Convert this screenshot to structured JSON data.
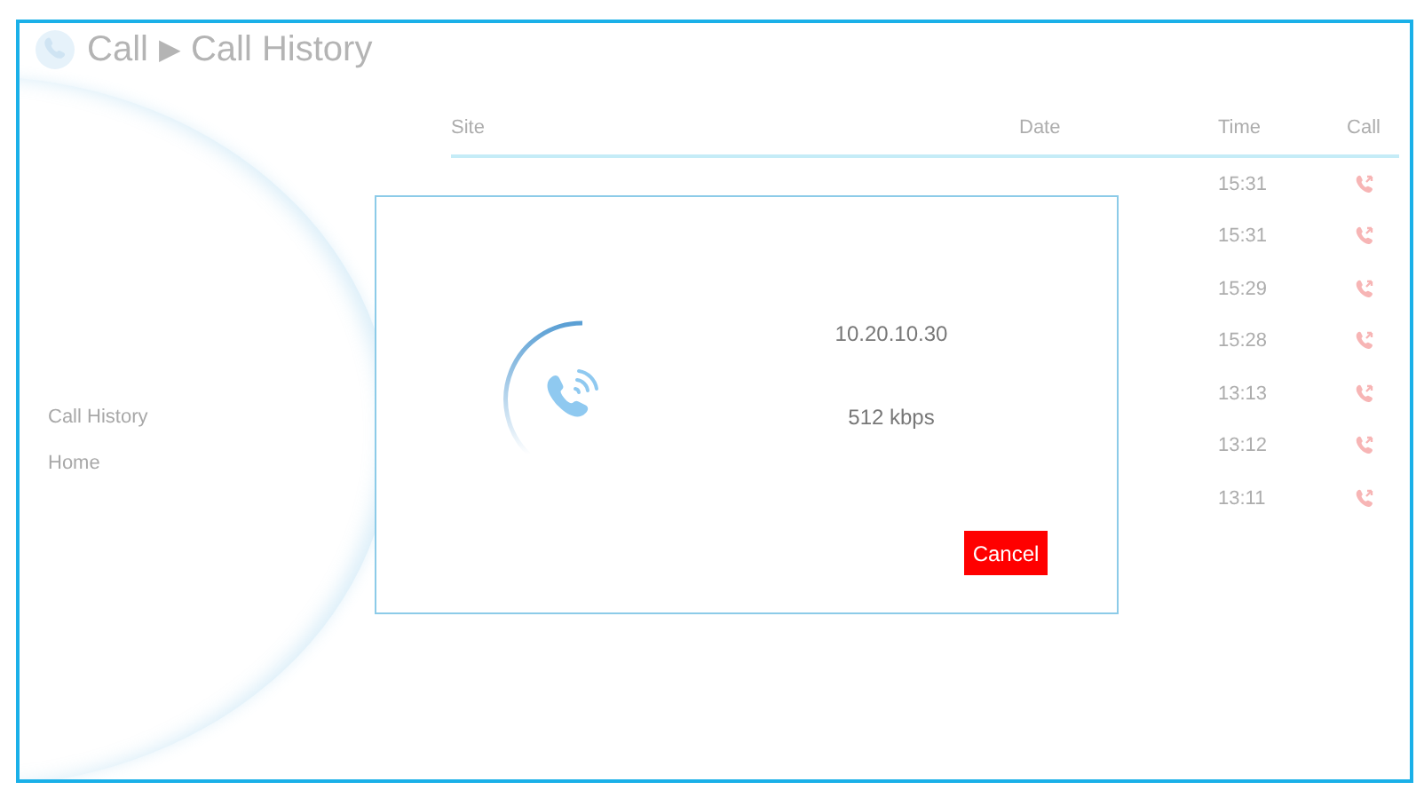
{
  "header": {
    "breadcrumb_root": "Call",
    "separator": "▶",
    "breadcrumb_current": "Call History"
  },
  "sidebar": {
    "items": [
      {
        "label": "Call History"
      },
      {
        "label": "Home"
      }
    ]
  },
  "table": {
    "columns": [
      "Site",
      "Date",
      "Time",
      "Call"
    ],
    "rows": [
      {
        "time": "15:31"
      },
      {
        "time": "15:31"
      },
      {
        "time": "15:29"
      },
      {
        "time": "15:28"
      },
      {
        "time": "13:13"
      },
      {
        "time": "13:12"
      },
      {
        "time": "13:11"
      }
    ]
  },
  "dialog": {
    "address": "10.20.10.30",
    "bitrate": "512 kbps",
    "cancel": "Cancel"
  }
}
